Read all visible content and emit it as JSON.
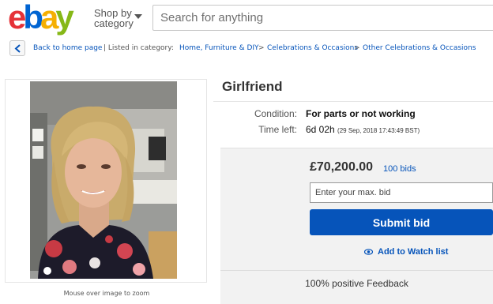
{
  "header": {
    "logo_letters": [
      "e",
      "b",
      "a",
      "y"
    ],
    "logo_colors": [
      "#e53238",
      "#0064d2",
      "#f5af02",
      "#86b817"
    ],
    "shop_by_line1": "Shop by",
    "shop_by_line2": "category",
    "search_placeholder": "Search for anything"
  },
  "breadcrumb": {
    "back_label": "Back to home page",
    "listed_in": "| Listed in category:",
    "items": [
      "Home, Furniture & DIY",
      "Celebrations & Occasions",
      "Other Celebrations & Occasions"
    ],
    "separator": ">"
  },
  "gallery": {
    "caption": "Mouse over image to zoom"
  },
  "listing": {
    "title": "Girlfriend",
    "condition_label": "Condition:",
    "condition_value": "For parts or not working",
    "time_left_label": "Time left:",
    "time_left_value": "6d 02h",
    "time_left_detail": "(29 Sep, 2018  17:43:49 BST)"
  },
  "bid": {
    "price": "£70,200.00",
    "bids_count": "100 bids",
    "max_bid_placeholder": "Enter your max. bid",
    "submit_label": "Submit bid",
    "watch_label": "Add to Watch list",
    "feedback": "100% positive Feedback"
  },
  "colors": {
    "link": "#0654ba",
    "button": "#0654ba",
    "panel": "#f2f2f2"
  }
}
